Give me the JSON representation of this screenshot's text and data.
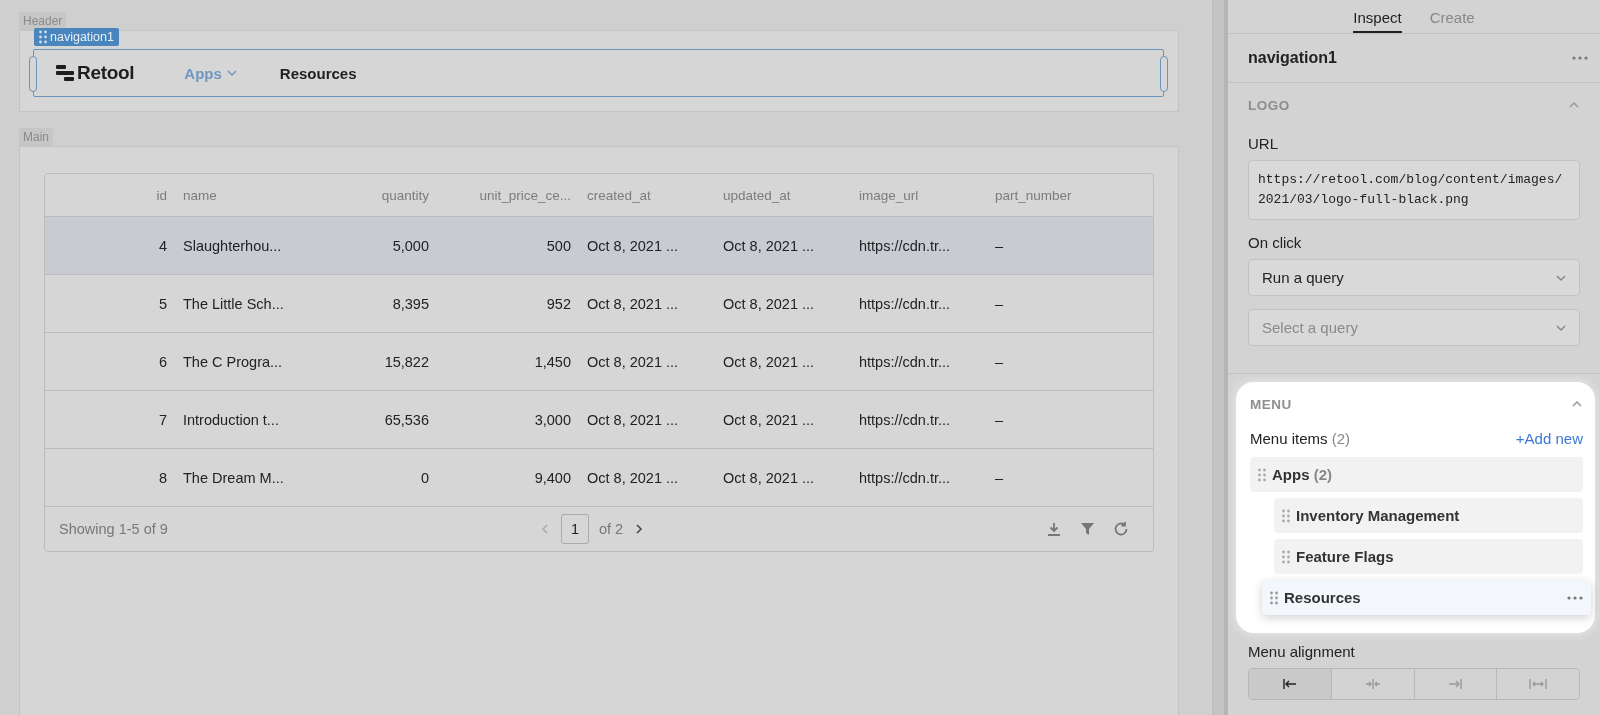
{
  "canvas": {
    "header_label": "Header",
    "main_label": "Main",
    "navigation": {
      "tag": "navigation1",
      "logo": "Retool",
      "items": [
        {
          "label": "Apps",
          "selected": true,
          "has_menu": true
        },
        {
          "label": "Resources",
          "selected": false,
          "has_menu": false
        }
      ]
    },
    "table": {
      "columns": [
        {
          "label": "id",
          "kind": "number"
        },
        {
          "label": "name",
          "kind": "text"
        },
        {
          "label": "quantity",
          "kind": "number"
        },
        {
          "label": "unit_price_ce...",
          "kind": "number"
        },
        {
          "label": "created_at",
          "kind": "text"
        },
        {
          "label": "updated_at",
          "kind": "text"
        },
        {
          "label": "image_url",
          "kind": "text"
        },
        {
          "label": "part_number",
          "kind": "text"
        }
      ],
      "rows": [
        {
          "selected": true,
          "cells": [
            "4",
            "Slaughterhou...",
            "5,000",
            "500",
            "Oct 8, 2021 ...",
            "Oct 8, 2021 ...",
            "https://cdn.tr...",
            "–"
          ]
        },
        {
          "selected": false,
          "cells": [
            "5",
            "The Little Sch...",
            "8,395",
            "952",
            "Oct 8, 2021 ...",
            "Oct 8, 2021 ...",
            "https://cdn.tr...",
            "–"
          ]
        },
        {
          "selected": false,
          "cells": [
            "6",
            "The C Progra...",
            "15,822",
            "1,450",
            "Oct 8, 2021 ...",
            "Oct 8, 2021 ...",
            "https://cdn.tr...",
            "–"
          ]
        },
        {
          "selected": false,
          "cells": [
            "7",
            "Introduction t...",
            "65,536",
            "3,000",
            "Oct 8, 2021 ...",
            "Oct 8, 2021 ...",
            "https://cdn.tr...",
            "–"
          ]
        },
        {
          "selected": false,
          "cells": [
            "8",
            "The Dream M...",
            "0",
            "9,400",
            "Oct 8, 2021 ...",
            "Oct 8, 2021 ...",
            "https://cdn.tr...",
            "–"
          ]
        }
      ],
      "footer": {
        "summary": "Showing 1-5 of 9",
        "page": "1",
        "page_total": "of 2",
        "prev_disabled": true
      }
    }
  },
  "inspector": {
    "tabs": [
      {
        "label": "Inspect",
        "selected": true
      },
      {
        "label": "Create",
        "selected": false
      }
    ],
    "component": "navigation1",
    "logo_section": {
      "title": "LOGO",
      "expanded": true,
      "url_label": "URL",
      "url": "https://retool.com/blog/content/images/2021/03/logo-full-black.png",
      "on_click_label": "On click",
      "action": {
        "value": "Run a query"
      },
      "query": {
        "placeholder": "Select a query"
      }
    },
    "menu_section": {
      "title": "MENU",
      "expanded": true,
      "items_label": "Menu items",
      "items_count": "(2)",
      "add_label": "+Add new",
      "items": [
        {
          "label": "Apps",
          "count": "(2)",
          "dragging": false,
          "children": [
            {
              "label": "Inventory Management",
              "dragging": false
            },
            {
              "label": "Feature Flags",
              "dragging": false
            }
          ]
        },
        {
          "label": "Resources",
          "dragging": true
        }
      ]
    },
    "alignment_label": "Menu alignment",
    "alignment": [
      {
        "kind": "left",
        "selected": true
      },
      {
        "kind": "center",
        "selected": false
      },
      {
        "kind": "right",
        "selected": false
      },
      {
        "kind": "justify",
        "selected": false
      }
    ]
  }
}
